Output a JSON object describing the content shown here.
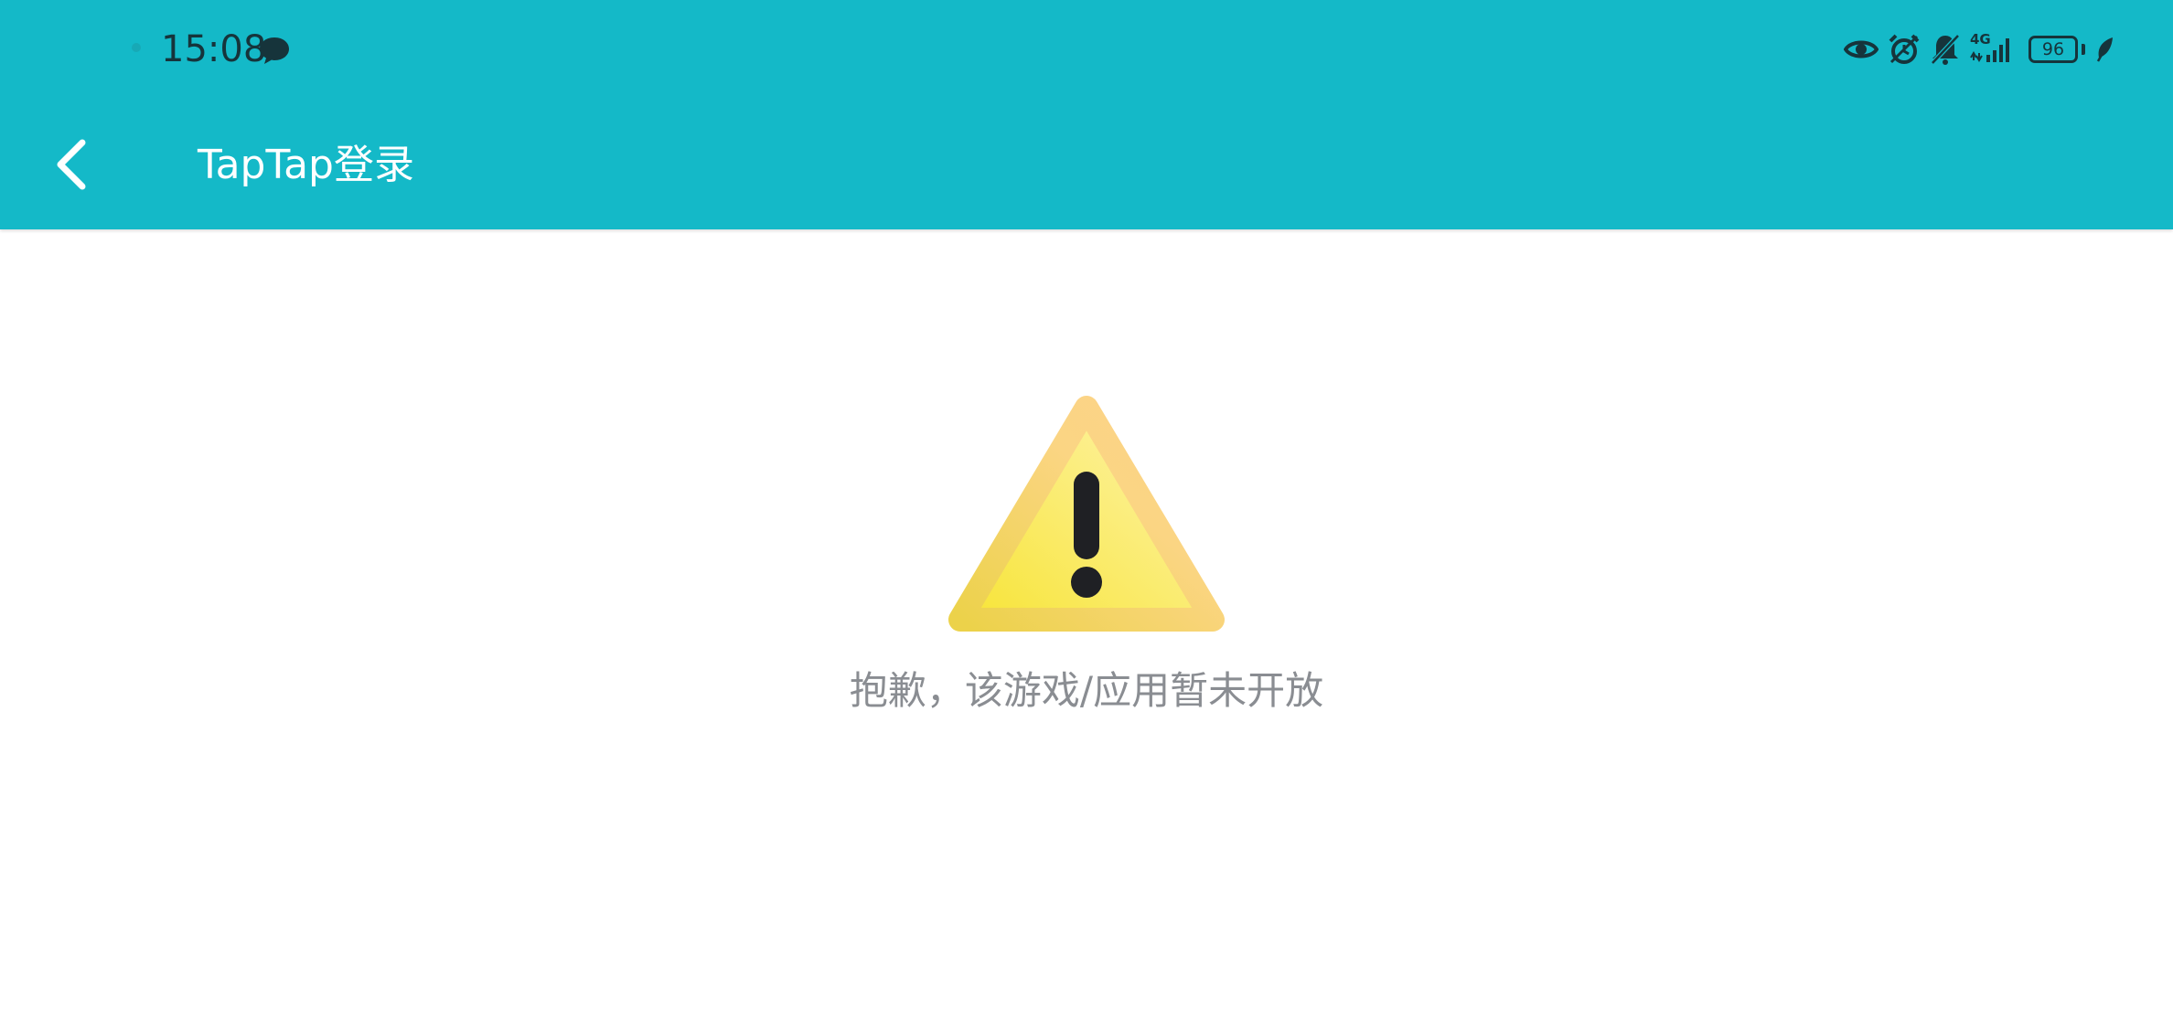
{
  "status_bar": {
    "time": "15:08",
    "battery_level": "96",
    "network_type": "4G",
    "icons": [
      "message-icon",
      "eye-icon",
      "alarm-icon",
      "bell-off-icon",
      "signal-icon",
      "battery-icon",
      "leaf-icon"
    ]
  },
  "app_bar": {
    "title": "TapTap登录",
    "back_icon": "chevron-left-icon"
  },
  "content": {
    "icon": "warning-icon",
    "message": "抱歉，该游戏/应用暂未开放"
  },
  "colors": {
    "header_background": "#14b9c8",
    "title_text": "#ffffff",
    "message_text": "#8a8d92",
    "warning_fill": "#f9e84a",
    "warning_border": "#fbd480"
  }
}
